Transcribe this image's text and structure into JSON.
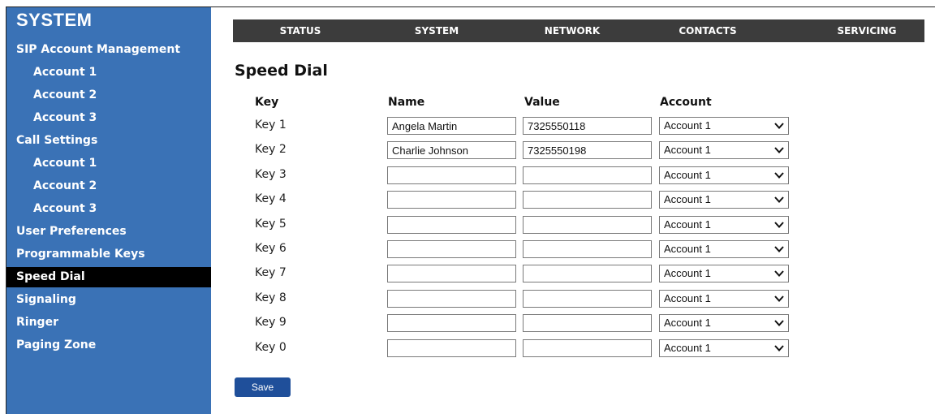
{
  "sidebar": {
    "title": "SYSTEM",
    "items": [
      {
        "label": "SIP Account Management",
        "level": "top",
        "active": false
      },
      {
        "label": "Account 1",
        "level": "sub",
        "active": false
      },
      {
        "label": "Account 2",
        "level": "sub",
        "active": false
      },
      {
        "label": "Account 3",
        "level": "sub",
        "active": false
      },
      {
        "label": "Call Settings",
        "level": "top",
        "active": false
      },
      {
        "label": "Account 1",
        "level": "sub",
        "active": false
      },
      {
        "label": "Account 2",
        "level": "sub",
        "active": false
      },
      {
        "label": "Account 3",
        "level": "sub",
        "active": false
      },
      {
        "label": "User Preferences",
        "level": "top",
        "active": false
      },
      {
        "label": "Programmable Keys",
        "level": "top",
        "active": false
      },
      {
        "label": "Speed Dial",
        "level": "top",
        "active": true
      },
      {
        "label": "Signaling",
        "level": "top",
        "active": false
      },
      {
        "label": "Ringer",
        "level": "top",
        "active": false
      },
      {
        "label": "Paging Zone",
        "level": "top",
        "active": false
      }
    ]
  },
  "topnav": {
    "items": [
      "STATUS",
      "SYSTEM",
      "NETWORK",
      "CONTACTS",
      "SERVICING"
    ]
  },
  "page": {
    "title": "Speed Dial",
    "headers": {
      "key": "Key",
      "name": "Name",
      "value": "Value",
      "account": "Account"
    },
    "rows": [
      {
        "key": "Key 1",
        "name": "Angela Martin",
        "value": "7325550118",
        "account": "Account 1"
      },
      {
        "key": "Key 2",
        "name": "Charlie Johnson",
        "value": "7325550198",
        "account": "Account 1"
      },
      {
        "key": "Key 3",
        "name": "",
        "value": "",
        "account": "Account 1"
      },
      {
        "key": "Key 4",
        "name": "",
        "value": "",
        "account": "Account 1"
      },
      {
        "key": "Key 5",
        "name": "",
        "value": "",
        "account": "Account 1"
      },
      {
        "key": "Key 6",
        "name": "",
        "value": "",
        "account": "Account 1"
      },
      {
        "key": "Key 7",
        "name": "",
        "value": "",
        "account": "Account 1"
      },
      {
        "key": "Key 8",
        "name": "",
        "value": "",
        "account": "Account 1"
      },
      {
        "key": "Key 9",
        "name": "",
        "value": "",
        "account": "Account 1"
      },
      {
        "key": "Key 0",
        "name": "",
        "value": "",
        "account": "Account 1"
      }
    ],
    "save_label": "Save"
  },
  "icons": {
    "select_arrow": "chevron-down-icon"
  },
  "colors": {
    "sidebar_bg": "#3a72b6",
    "active_bg": "#000000",
    "topnav_bg": "#3c3c3c",
    "save_bg": "#1f4f9a"
  }
}
